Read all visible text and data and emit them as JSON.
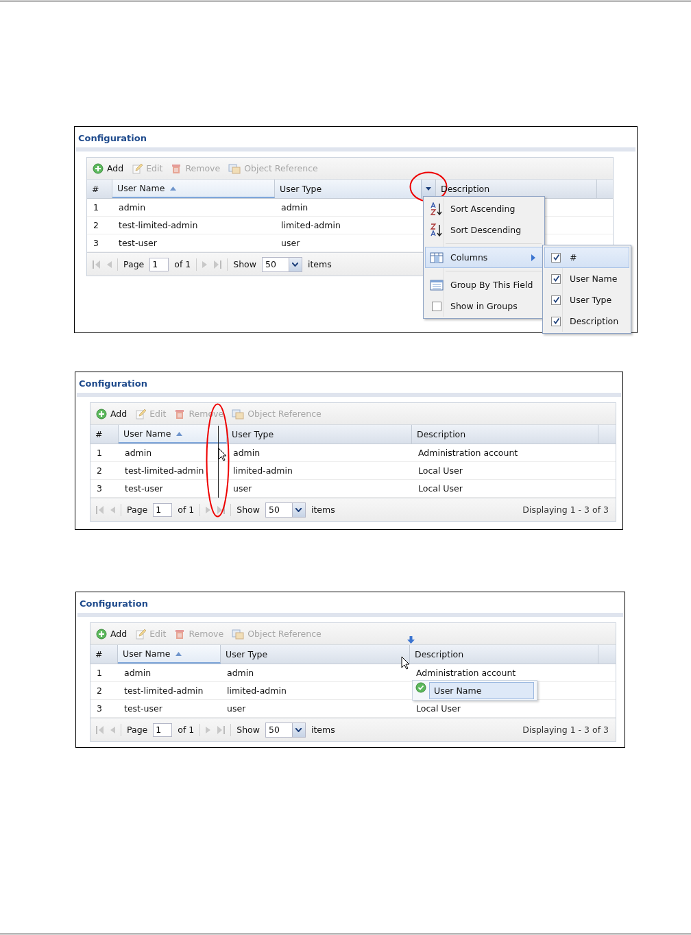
{
  "figures": [
    {
      "title": "Configuration",
      "toolbar": [
        {
          "label": "Add",
          "kind": "add",
          "disabled": false
        },
        {
          "label": "Edit",
          "kind": "edit",
          "disabled": true
        },
        {
          "label": "Remove",
          "kind": "remove",
          "disabled": true
        },
        {
          "label": "Object Reference",
          "kind": "reference",
          "disabled": true
        }
      ],
      "columns": [
        {
          "label": "#",
          "sorted": false,
          "menu_open": false
        },
        {
          "label": "User Name",
          "sorted": true,
          "menu_open": false
        },
        {
          "label": "User Type",
          "sorted": false,
          "menu_open": true
        },
        {
          "label": "Description",
          "sorted": false,
          "menu_open": false
        }
      ],
      "rows": [
        [
          "1",
          "admin",
          "admin"
        ],
        [
          "2",
          "test-limited-admin",
          "limited-admin"
        ],
        [
          "3",
          "test-user",
          "user"
        ]
      ],
      "pager": {
        "page_label": "Page",
        "page": "1",
        "of": "of 1",
        "show": "Show",
        "size": "50",
        "items": "items"
      },
      "overlay": {
        "kind": "column_menu",
        "menu": [
          {
            "label": "Sort Ascending",
            "kind": "sort_asc",
            "selected": false
          },
          {
            "label": "Sort Descending",
            "kind": "sort_desc",
            "selected": false
          },
          {
            "label": "Columns",
            "kind": "columns",
            "selected": true
          },
          {
            "label": "Group By This Field",
            "kind": "group",
            "selected": false
          },
          {
            "label": "Show in Groups",
            "kind": "checkbox",
            "checked": false,
            "selected": false
          }
        ],
        "submenu": [
          {
            "label": "#",
            "checked": true,
            "selected": true
          },
          {
            "label": "User Name",
            "checked": true,
            "selected": false
          },
          {
            "label": "User Type",
            "checked": true,
            "selected": false
          },
          {
            "label": "Description",
            "checked": true,
            "selected": false
          }
        ]
      }
    },
    {
      "title": "Configuration",
      "toolbar": [
        {
          "label": "Add",
          "kind": "add",
          "disabled": false
        },
        {
          "label": "Edit",
          "kind": "edit",
          "disabled": true
        },
        {
          "label": "Remove",
          "kind": "remove",
          "disabled": true
        },
        {
          "label": "Object Reference",
          "kind": "reference",
          "disabled": true
        }
      ],
      "columns": [
        {
          "label": "#",
          "sorted": false,
          "menu_open": false
        },
        {
          "label": "User Name",
          "sorted": true,
          "menu_open": false
        },
        {
          "label": "User Type",
          "sorted": false,
          "menu_open": false
        },
        {
          "label": "Description",
          "sorted": false,
          "menu_open": false
        }
      ],
      "rows": [
        [
          "1",
          "admin",
          "admin",
          "Administration account"
        ],
        [
          "2",
          "test-limited-admin",
          "limited-admin",
          "Local User"
        ],
        [
          "3",
          "test-user",
          "user",
          "Local User"
        ]
      ],
      "pager": {
        "page_label": "Page",
        "page": "1",
        "of": "of 1",
        "show": "Show",
        "size": "50",
        "items": "items",
        "displaying": "Displaying 1 - 3 of 3"
      },
      "overlay": {
        "kind": "column_resize"
      }
    },
    {
      "title": "Configuration",
      "toolbar": [
        {
          "label": "Add",
          "kind": "add",
          "disabled": false
        },
        {
          "label": "Edit",
          "kind": "edit",
          "disabled": true
        },
        {
          "label": "Remove",
          "kind": "remove",
          "disabled": true
        },
        {
          "label": "Object Reference",
          "kind": "reference",
          "disabled": true
        }
      ],
      "columns": [
        {
          "label": "#",
          "sorted": false,
          "menu_open": false
        },
        {
          "label": "User Name",
          "sorted": true,
          "menu_open": false
        },
        {
          "label": "User Type",
          "sorted": false,
          "menu_open": false
        },
        {
          "label": "Description",
          "sorted": false,
          "menu_open": false
        }
      ],
      "rows": [
        [
          "1",
          "admin",
          "admin",
          "Administration account"
        ],
        [
          "2",
          "test-limited-admin",
          "limited-admin"
        ],
        [
          "3",
          "test-user",
          "user",
          "Local User"
        ]
      ],
      "pager": {
        "page_label": "Page",
        "page": "1",
        "of": "of 1",
        "show": "Show",
        "size": "50",
        "items": "items",
        "displaying": "Displaying 1 - 3 of 3"
      },
      "overlay": {
        "kind": "column_drag",
        "proxy_label": "User Name"
      }
    }
  ]
}
